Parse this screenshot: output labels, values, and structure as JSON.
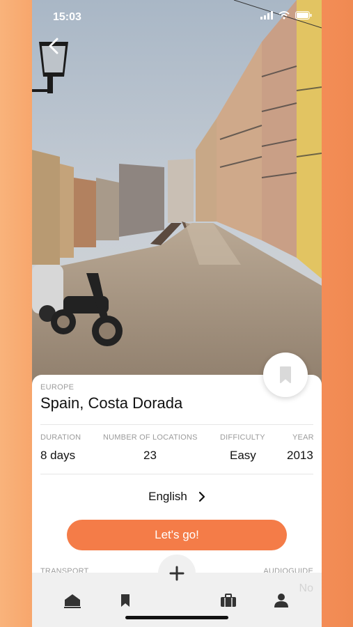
{
  "status_bar": {
    "time": "15:03"
  },
  "tour": {
    "region": "EUROPE",
    "title": "Spain, Costa Dorada",
    "stats": [
      {
        "label": "DURATION",
        "value": "8 days"
      },
      {
        "label": "NUMBER OF LOCATIONS",
        "value": "23"
      },
      {
        "label": "DIFFICULTY",
        "value": "Easy"
      },
      {
        "label": "YEAR",
        "value": "2013"
      }
    ],
    "language": "English",
    "cta": "Let's go!",
    "transport_label": "TRANSPORT",
    "audioguide_label": "AUDIOGUIDE",
    "audioguide_value": "No"
  },
  "tabbar": {
    "tabs": [
      "home-icon",
      "bookmark-icon",
      "plus-icon",
      "suitcase-icon",
      "profile-icon"
    ]
  },
  "colors": {
    "accent": "#f47c48",
    "background": "#f8a466"
  }
}
